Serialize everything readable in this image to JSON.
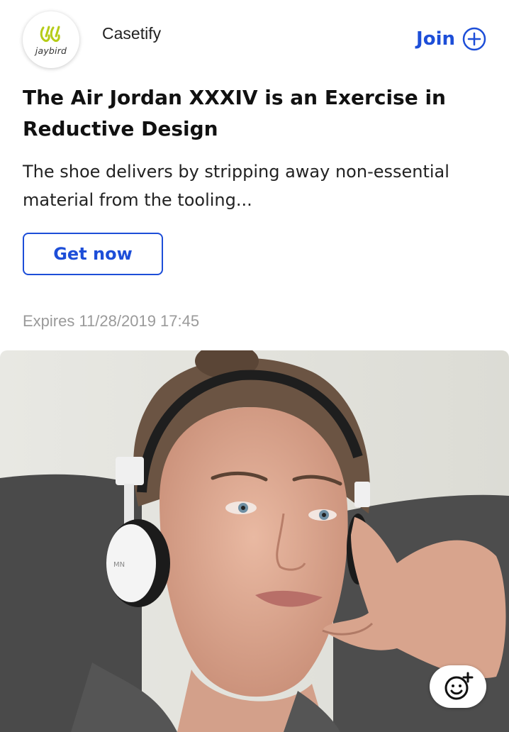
{
  "post": {
    "brand_logo_text": "jaybird",
    "brand_name": "Casetify",
    "join_label": "Join",
    "title": "The Air Jordan XXXIV is an Exercise in Reductive Design",
    "description": "The shoe delivers by stripping away non-essential material from the tooling...",
    "cta_label": "Get now",
    "expires": "Expires 11/28/2019 17:45"
  },
  "colors": {
    "accent": "#1d4ed8",
    "logo_green": "#b5cc18",
    "muted_text": "#9a9a9a"
  },
  "icons": {
    "join": "plus-circle-icon",
    "reaction": "smiley-add-icon"
  }
}
